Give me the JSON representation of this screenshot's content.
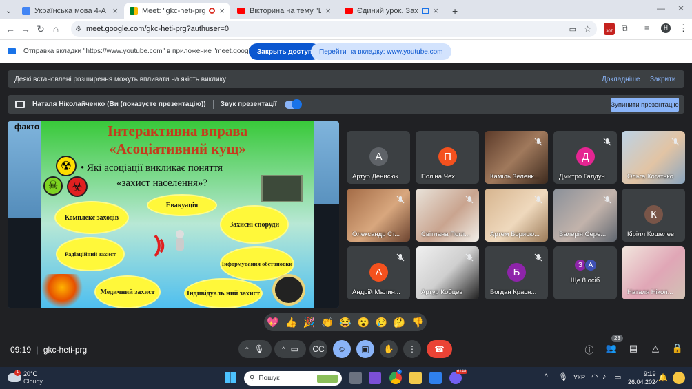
{
  "browser": {
    "tabs": [
      {
        "title": "Українська мова 4-А",
        "active": false
      },
      {
        "title": "Meet: \"gkc-heti-prg\"",
        "active": true
      },
      {
        "title": "Вікторина на тему \"Цивільний",
        "active": false
      },
      {
        "title": "Єдиний урок. Захисти свої",
        "active": false
      }
    ],
    "new_tab": "+",
    "url": "meet.google.com/gkc-heti-prg?authuser=0",
    "profile_initial": "H",
    "ext_badge": "307"
  },
  "infobar": {
    "message": "Отправка вкладки \"https://www.youtube.com\" в приложение \"meet.google.com\"...",
    "stop_label": "Закрыть доступ",
    "switch_label": "Перейти на вкладку: www.youtube.com"
  },
  "meet": {
    "banner": {
      "text": "Деякі встановлені розширення можуть впливати на якість виклику",
      "details": "Докладніше",
      "close": "Закрити"
    },
    "presenting": {
      "text": "Наталя Ніколайченко (Ви (показуєте презентацію))",
      "sound_label": "Звук презентації",
      "stop_label": "Зупинити презентацію"
    },
    "slide": {
      "corner_text": "факто",
      "title1": "Інтерактивна вправа",
      "title2": "«Асоціативний кущ»",
      "question1": "• Які асоціації викликає поняття",
      "question2": "«захист населення»?",
      "bubbles": [
        "Комплекс заходів",
        "Евакуація",
        "Захисні споруди",
        "Радіаційний захист",
        "Інформування обстановки",
        "Медичний захист",
        "Індивідуаль ний захист"
      ]
    },
    "participants": [
      {
        "name": "Артур Денисюк",
        "initial": "А",
        "color": "#5f6368"
      },
      {
        "name": "Поліна Чех",
        "initial": "П",
        "color": "#f4511e"
      },
      {
        "name": "Каміль Зеленк...",
        "initial": "",
        "color": ""
      },
      {
        "name": "Дмитро Галдун",
        "initial": "Д",
        "color": "#e52592"
      },
      {
        "name": "Ольга Когатько",
        "initial": "",
        "color": ""
      },
      {
        "name": "Олександр Ст...",
        "initial": "",
        "color": ""
      },
      {
        "name": "Світлана Погл...",
        "initial": "",
        "color": ""
      },
      {
        "name": "Артем Борисю...",
        "initial": "",
        "color": ""
      },
      {
        "name": "Валерія Сере...",
        "initial": "",
        "color": ""
      },
      {
        "name": "Кірілл Кошелев",
        "initial": "К",
        "color": "#795548"
      },
      {
        "name": "Андрій Малин...",
        "initial": "А",
        "color": "#f4511e"
      },
      {
        "name": "Артур Кобцев",
        "initial": "",
        "color": ""
      },
      {
        "name": "Богдан Красн...",
        "initial": "Б",
        "color": "#8e24aa"
      },
      {
        "name": "Ще 8 осіб",
        "initial": "",
        "color": ""
      },
      {
        "name": "Наталя Нікол...",
        "initial": "",
        "color": ""
      }
    ],
    "more_avatars": [
      "З",
      "А"
    ],
    "reactions": [
      "💖",
      "👍",
      "🎉",
      "👏",
      "😂",
      "😮",
      "😢",
      "🤔",
      "👎"
    ],
    "time": "09:19",
    "meeting_code": "gkc-heti-prg",
    "people_count": "23"
  },
  "taskbar": {
    "weather_temp": "20°C",
    "weather_desc": "Cloudy",
    "weather_badge": "1",
    "search_placeholder": "Пошук",
    "lang": "УКР",
    "clock_time": "9:19",
    "clock_date": "26.04.2024",
    "meet_badge": "9",
    "viber_badge": "6148"
  }
}
